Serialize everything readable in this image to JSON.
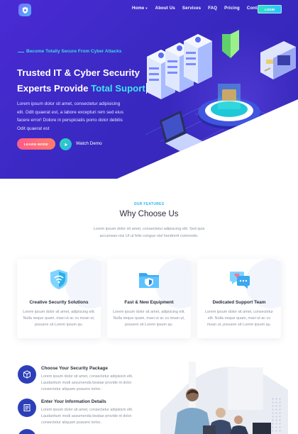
{
  "nav": {
    "items": [
      "Home",
      "About Us",
      "Services",
      "FAQ",
      "Pricing",
      "Contact"
    ],
    "login": "LOGIN"
  },
  "hero": {
    "tagline": "Become Totally Secure From Cyber Attacks",
    "headline_line1": "Trusted IT & Cyber Security",
    "headline_line2": "Experts Provide ",
    "headline_accent": "Total Suport",
    "description": "Lorem ipsum dolor sit amet, consectetur adipisicing elit. Odit quaerat est, a labore excepturi rem sed eius facere error! Dolore in perspiciatis porro dolor debitis Odit quaerat est",
    "learn_more": "LEARN MORE",
    "watch_demo": "Watch Demo"
  },
  "features": {
    "label": "OUR FEATURES",
    "title": "Why Choose Us",
    "description": "Lorem ipsum dolor sit amet, consectetur adipiscing elit. Sed quis accumsan nisi Ut ut felis congue nisl hendrerit commodo.",
    "cards": [
      {
        "title": "Creative Security Solutions",
        "desc": "Lorem ipsum dolor sit amet, adipiscing elit. Nulla neque quam, maxi ut ac cu msan ut, posuere sit Lorem ipsum qu."
      },
      {
        "title": "Fast & New Equipment",
        "desc": "Lorem ipsum dolor sit amet, adipiscing elit. Nulla neque quam, maxi ut ac cu msan ut, posuere sit Lorem ipsum qu."
      },
      {
        "title": "Dedicated Support Team",
        "desc": "Lorem ipsum dolor sit amet, consectetur elit. Nulla neque quam, maxi ut ac cu msan ut, posuere sit Lorem ipsum qu."
      }
    ]
  },
  "steps": [
    {
      "title": "Choose Your Security Package",
      "desc": "Lorem ipsum dolor sit amet, consectetur adipisicin elit. Laudantium modi assumenda beatae provide nt dolor consectetur aliquam posuere tortor.."
    },
    {
      "title": "Enter Your Information Details",
      "desc": "Lorem ipsum dolor sit amet, consectetur adipisicin elit. Laudantium modi assumenda beatae provide nt dolor consectetur aliquam posuere tortor.."
    }
  ],
  "colors": {
    "hero_bg": "#3a29c2",
    "accent_cyan": "#3fe5f5",
    "cta_pink": "#ff5c8a",
    "feature_label": "#2bb5f0",
    "step_icon_bg": "#2d3fb8"
  },
  "icons": [
    "shield-logo-icon",
    "play-icon",
    "shield-wifi-icon",
    "folder-shield-icon",
    "chat-heart-icon",
    "package-icon",
    "form-icon"
  ]
}
